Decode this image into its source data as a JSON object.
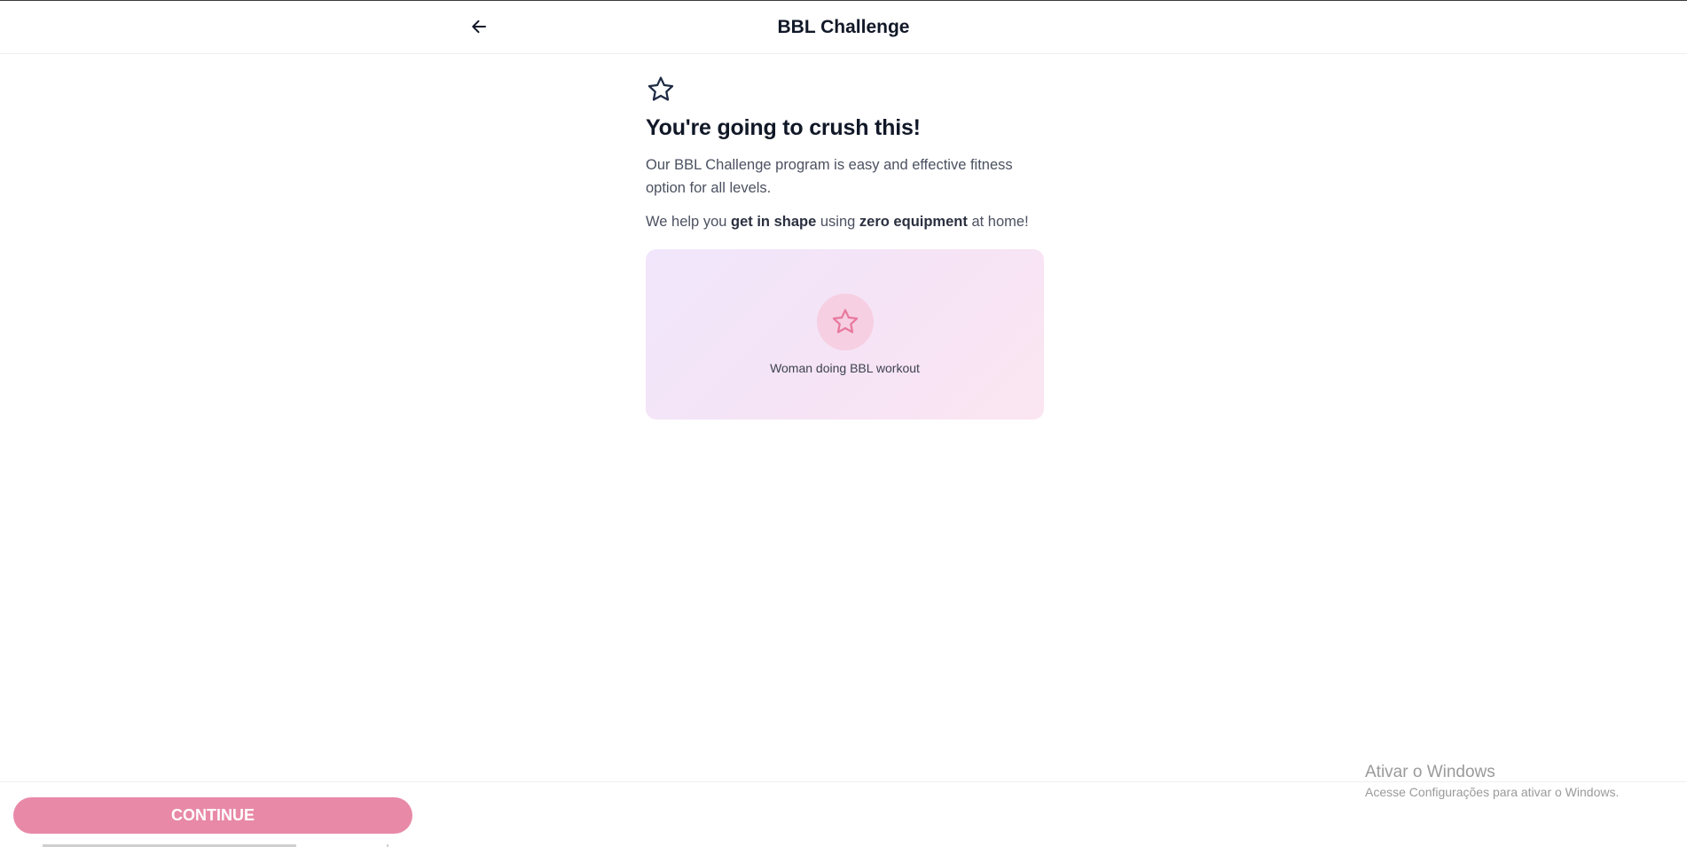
{
  "header": {
    "title": "BBL Challenge",
    "back_icon": "arrow-left-icon"
  },
  "main": {
    "top_icon": "star-icon",
    "headline": "You're going to crush this!",
    "paragraph1": "Our BBL Challenge program is easy and effective fitness option for all levels.",
    "paragraph2": {
      "part1": "We help you ",
      "bold1": "get in shape",
      "part2": " using ",
      "bold2": "zero equipment",
      "part3": " at home!"
    },
    "image_placeholder": {
      "icon": "star-icon",
      "caption": "Woman doing BBL workout"
    }
  },
  "footer": {
    "continue_label": "CONTINUE"
  },
  "watermark": {
    "title": "Ativar o Windows",
    "subtitle": "Acesse Configurações para ativar o Windows."
  },
  "colors": {
    "accent": "#e889a8",
    "star_pink": "#e8799d",
    "circle_bg": "#f6cfe2",
    "text_dark": "#111827"
  }
}
